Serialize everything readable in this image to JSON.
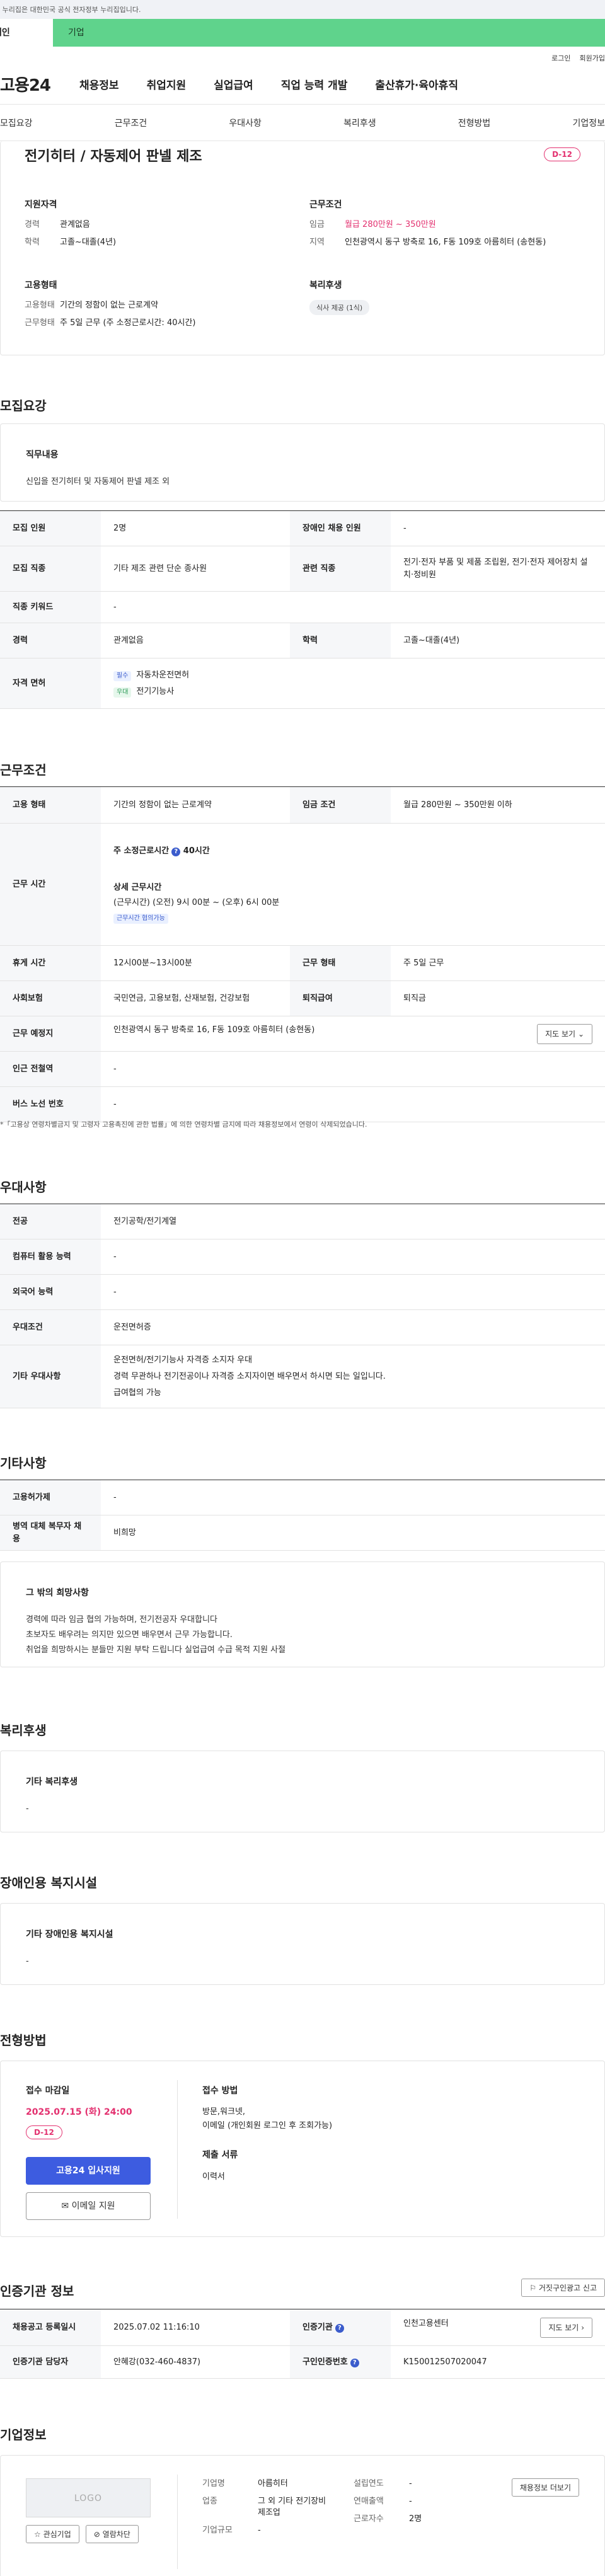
{
  "header": {
    "gov_banner": "이 누리집은 대한민국 공식 전자정부 누리집입니다.",
    "tab_person": "개인",
    "tab_corp": "기업",
    "login": "로그인",
    "join": "회원가입",
    "logo": "고용24",
    "menu": [
      "채용정보",
      "취업지원",
      "실업급여",
      "직업 능력 개발",
      "출산휴가·육아휴직"
    ]
  },
  "subnav": [
    "모집요강",
    "근무조건",
    "우대사항",
    "복리후생",
    "전형방법",
    "기업정보"
  ],
  "summary": {
    "title": "전기히터 / 자동제어 판넬 제조",
    "dday": "D-12",
    "qual_head": "지원자격",
    "career_k": "경력",
    "career_v": "관계없음",
    "edu_k": "학력",
    "edu_v": "고졸~대졸(4년)",
    "work_head": "근무조건",
    "pay_k": "임금",
    "pay_v": "월급 280만원 ~ 350만원",
    "loc_k": "지역",
    "loc_v": "인천광역시 동구 방축로 16, F동 109호 아름히터 (송현동)",
    "emp_head": "고용형태",
    "type_k": "고용형태",
    "type_v": "기간의 정함이 없는 근로계약",
    "form_k": "근무형태",
    "form_v": "주 5일 근무 (주 소정근로시간: 40시간)",
    "welfare_head": "복리후생",
    "welfare_pill": "식사 제공 (1식)"
  },
  "recruit": {
    "title": "모집요강",
    "duty_head": "직무내용",
    "duty_text": "신입을 전기히터 및 자동제어 판넬 제조 외",
    "rows": {
      "count_k": "모집 인원",
      "count_v": "2명",
      "disabled_k": "장애인 채용 인원",
      "disabled_v": "-",
      "job_k": "모집 직종",
      "job_v": "기타 제조 관련 단순 종사원",
      "related_k": "관련 직종",
      "related_v": "전기·전자 부품 및 제품 조립원, 전기·전자 제어장치 설치·정비원",
      "keyword_k": "직종 키워드",
      "keyword_v": "-",
      "career_k": "경력",
      "career_v": "관계없음",
      "edu_k": "학력",
      "edu_v": "고졸~대졸(4년)",
      "license_k": "자격 면허",
      "license_must_tag": "필수",
      "license_must": "자동차운전면허",
      "license_pref_tag": "우대",
      "license_pref": "전기기능사"
    }
  },
  "condition": {
    "title": "근무조건",
    "type_k": "고용 형태",
    "type_v": "기간의 정함이 없는 근로계약",
    "pay_k": "임금 조건",
    "pay_v": "월급 280만원 ~ 350만원 이하",
    "hours_k": "근무 시간",
    "hours_weekly": "주 소정근로시간",
    "hours_weekly_v": "40시간",
    "hours_detail_head": "상세 근무시간",
    "hours_detail": "(근무시간) (오전) 9시 00분 ~ (오후) 6시 00분",
    "hours_badge": "근무시간 협의가능",
    "rest_k": "휴게 시간",
    "rest_v": "12시00분~13시00분",
    "form_k": "근무 형태",
    "form_v": "주 5일 근무",
    "insurance_k": "사회보험",
    "insurance_v": "국민연금, 고용보험, 산재보험, 건강보험",
    "severance_k": "퇴직급여",
    "severance_v": "퇴직금",
    "place_k": "근무 예정지",
    "place_v": "인천광역시 동구 방축로 16, F동 109호 아름히터 (송현동)",
    "map_btn": "지도 보기",
    "subway_k": "인근 전철역",
    "subway_v": "-",
    "bus_k": "버스 노선 번호",
    "bus_v": "-",
    "note": "*「고용상 연령차별금지 및 고령자 고용촉진에 관한 법률」에 의한 연령차별 금지에 따라 채용정보에서 연령이 삭제되었습니다."
  },
  "prefer": {
    "title": "우대사항",
    "major_k": "전공",
    "major_v": "전기공학/전기계열",
    "pc_k": "컴퓨터 활용 능력",
    "pc_v": "-",
    "lang_k": "외국어 능력",
    "lang_v": "-",
    "cond_k": "우대조건",
    "cond_v": "운전면허증",
    "etc_k": "기타 우대사항",
    "etc_lines": [
      "운전면허/전기기능사 자격증 소지자 우대",
      "경력 무관하나 전기전공이나 자격증 소지자이면 배우면서 하시면 되는 일입니다.",
      "급여협의 가능"
    ]
  },
  "other": {
    "title": "기타사항",
    "hire_k": "고용허가제",
    "hire_v": "-",
    "military_k": "병역 대체 복무자 채용",
    "military_v": "비희망",
    "hope_head": "그 밖의 희망사항",
    "hope_lines": [
      "경력에 따라 임금 협의 가능하며, 전기전공자 우대합니다",
      "초보자도 배우려는 의지만 있으면 배우면서 근무 가능합니다.",
      "취업을 희망하시는 분들만 지원 부탁 드립니다 실업급여 수급 목적 지원 사절"
    ]
  },
  "welfare": {
    "title": "복리후생",
    "head": "기타 복리후생",
    "text": "-"
  },
  "disabled": {
    "title": "장애인용 복지시설",
    "head": "기타 장애인용 복지시설",
    "text": "-"
  },
  "selection": {
    "title": "전형방법",
    "deadline_head": "접수 마감일",
    "deadline": "2025.07.15 (화) 24:00",
    "dday": "D-12",
    "apply_btn": "고용24 입사지원",
    "email_btn": "이메일 지원",
    "method_head": "접수 방법",
    "method_lines": [
      "방문,워크넷,",
      "이메일 (개인회원 로그인 후 조회가능)"
    ],
    "docs_head": "제출 서류",
    "docs": "이력서"
  },
  "cert": {
    "title": "인증기관 정보",
    "report_btn": "거짓구인광고 신고",
    "reg_k": "채용공고 등록일시",
    "reg_v": "2025.07.02 11:16:10",
    "org_k": "인증기관",
    "org_v": "인천고용센터",
    "map_btn": "지도 보기",
    "person_k": "인증기관 담당자",
    "person_v": "안혜강(032-460-4837)",
    "no_k": "구인인증번호",
    "no_v": "K150012507020047"
  },
  "company": {
    "title": "기업정보",
    "logo": "LOGO",
    "fav_btn": "관심기업",
    "block_btn": "열람차단",
    "name_k": "기업명",
    "name_v": "아름히터",
    "industry_k": "업종",
    "industry_v": "그 외 기타 전기장비 제조업",
    "size_k": "기업규모",
    "size_v": "-",
    "year_k": "설립연도",
    "year_v": "-",
    "sales_k": "연매출액",
    "sales_v": "-",
    "staff_k": "근로자수",
    "staff_v": "2명",
    "jobs_btn": "채용정보 더보기"
  },
  "colors": {
    "brand_green": "#5fd38c",
    "accent_blue": "#3d5ce0",
    "dday_pink": "#e3306f"
  }
}
